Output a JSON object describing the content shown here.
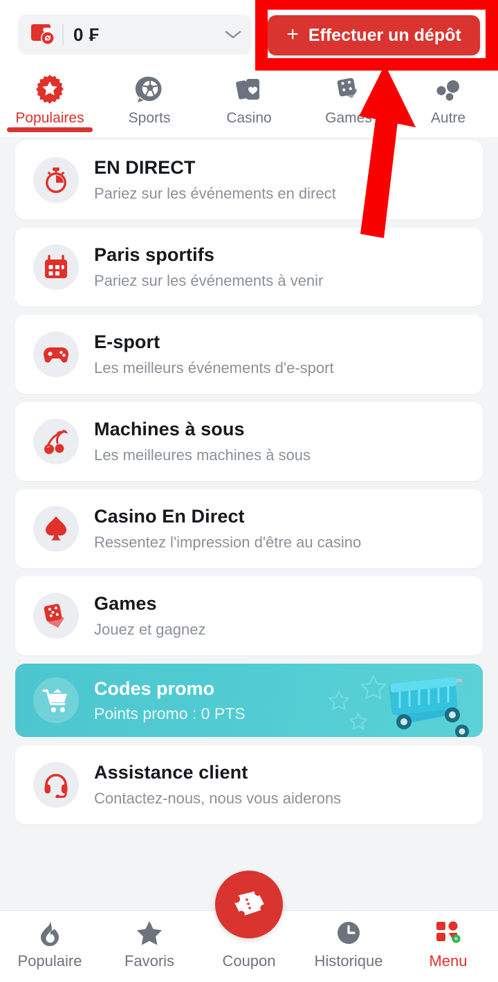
{
  "topbar": {
    "balance": "0 ₣",
    "wallet_icon": "wallet-refresh-icon",
    "chevron_icon": "chevron-down-icon",
    "deposit_plus": "+",
    "deposit_label": "Effectuer un dépôt"
  },
  "annotation": {
    "highlight_color": "#fa0000",
    "arrow_color": "#fa0000",
    "target": "deposit-button"
  },
  "tabs": [
    {
      "label": "Populaires",
      "icon": "badge-star-icon",
      "active": true
    },
    {
      "label": "Sports",
      "icon": "soccer-ball-icon",
      "active": false
    },
    {
      "label": "Casino",
      "icon": "playing-cards-heart-icon",
      "active": false
    },
    {
      "label": "Games",
      "icon": "dice-icon",
      "active": false
    },
    {
      "label": "Autre",
      "icon": "three-dots-icon",
      "active": false
    }
  ],
  "list": [
    {
      "title": "EN DIRECT",
      "subtitle": "Pariez sur les événements en direct",
      "icon": "stopwatch-icon"
    },
    {
      "title": "Paris sportifs",
      "subtitle": "Pariez sur les événements à venir",
      "icon": "calendar-icon"
    },
    {
      "title": "E-sport",
      "subtitle": "Les meilleurs événements d'e-sport",
      "icon": "gamepad-icon"
    },
    {
      "title": "Machines à sous",
      "subtitle": "Les meilleures machines à sous",
      "icon": "cherries-icon"
    },
    {
      "title": "Casino En Direct",
      "subtitle": "Ressentez l'impression d'être au casino",
      "icon": "spade-icon"
    },
    {
      "title": "Games",
      "subtitle": "Jouez et gagnez",
      "icon": "dice-cards-icon"
    }
  ],
  "promo": {
    "title": "Codes promo",
    "subtitle": "Points promo : 0 PTS",
    "icon": "shopping-cart-icon",
    "art": "shopping-cart-3d-art",
    "bg_color": "#51cbd2"
  },
  "support": {
    "title": "Assistance client",
    "subtitle": "Contactez-nous, nous vous aiderons",
    "icon": "headset-icon"
  },
  "bottomnav": [
    {
      "label": "Populaire",
      "icon": "flame-icon",
      "active": false
    },
    {
      "label": "Favoris",
      "icon": "star-icon",
      "active": false
    },
    {
      "label": "Coupon",
      "icon": "ticket-icon",
      "active": false
    },
    {
      "label": "Historique",
      "icon": "clock-icon",
      "active": false
    },
    {
      "label": "Menu",
      "icon": "grid-menu-icon",
      "active": true
    }
  ],
  "colors": {
    "brand_red": "#d9342f",
    "accent_red": "#e0312b",
    "muted_gray": "#6d737e",
    "page_bg": "#f2f4f6",
    "card_bg": "#ffffff",
    "promo_teal": "#51cbd2",
    "badge_green": "#2bb24c"
  }
}
